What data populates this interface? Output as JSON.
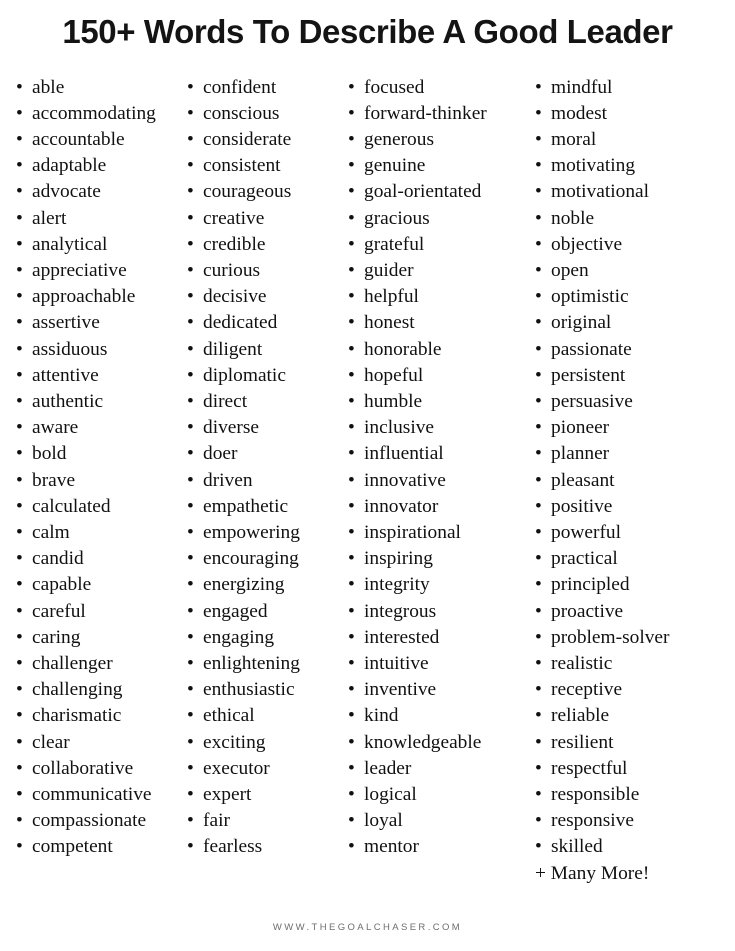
{
  "header": {
    "title": "150+ Words To Describe A Good Leader"
  },
  "list": {
    "bullet_glyph": "•",
    "columns": [
      {
        "id": "column-1",
        "items": [
          "able",
          "accommodating",
          "accountable",
          "adaptable",
          "advocate",
          "alert",
          "analytical",
          "appreciative",
          "approachable",
          "assertive",
          "assiduous",
          "attentive",
          "authentic",
          "aware",
          "bold",
          "brave",
          "calculated",
          "calm",
          "candid",
          "capable",
          "careful",
          "caring",
          "challenger",
          "challenging",
          "charismatic",
          "clear",
          "collaborative",
          "communicative",
          "compassionate",
          "competent"
        ],
        "trailing_note": ""
      },
      {
        "id": "column-2",
        "items": [
          "confident",
          "conscious",
          "considerate",
          "consistent",
          "courageous",
          "creative",
          "credible",
          "curious",
          "decisive",
          "dedicated",
          "diligent",
          "diplomatic",
          "direct",
          "diverse",
          "doer",
          "driven",
          "empathetic",
          "empowering",
          "encouraging",
          "energizing",
          "engaged",
          "engaging",
          "enlightening",
          "enthusiastic",
          "ethical",
          "exciting",
          "executor",
          "expert",
          "fair",
          "fearless"
        ],
        "trailing_note": ""
      },
      {
        "id": "column-3",
        "items": [
          "focused",
          "forward-thinker",
          "generous",
          "genuine",
          "goal-orientated",
          "gracious",
          "grateful",
          "guider",
          "helpful",
          "honest",
          "honorable",
          "hopeful",
          "humble",
          "inclusive",
          "influential",
          "innovative",
          "innovator",
          "inspirational",
          "inspiring",
          "integrity",
          "integrous",
          "interested",
          "intuitive",
          "inventive",
          "kind",
          "knowledgeable",
          "leader",
          "logical",
          "loyal",
          "mentor"
        ],
        "trailing_note": ""
      },
      {
        "id": "column-4",
        "items": [
          "mindful",
          "modest",
          "moral",
          "motivating",
          "motivational",
          "noble",
          "objective",
          "open",
          "optimistic",
          "original",
          "passionate",
          "persistent",
          "persuasive",
          "pioneer",
          "planner",
          "pleasant",
          "positive",
          "powerful",
          "practical",
          "principled",
          "proactive",
          "problem-solver",
          "realistic",
          "receptive",
          "reliable",
          "resilient",
          "respectful",
          "responsible",
          "responsive",
          "skilled"
        ],
        "trailing_note": "+ Many More!"
      }
    ]
  },
  "footer": {
    "url": "WWW.THEGOALCHASER.COM"
  },
  "colors": {
    "background": "#ffffff",
    "title_text": "#141414",
    "body_text": "#111111",
    "footer_text": "#6e6e6e"
  }
}
